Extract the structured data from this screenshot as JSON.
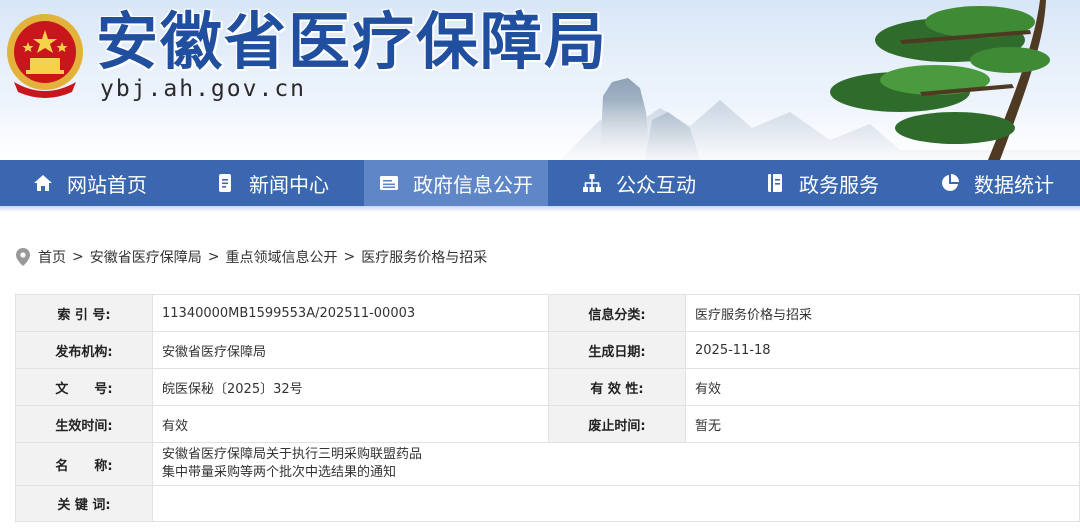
{
  "header": {
    "site_title": "安徽省医疗保障局",
    "site_url": "ybj.ah.gov.cn",
    "emblem_icon": "national-emblem-icon",
    "brand_color": "#1f4f9e"
  },
  "nav": {
    "items": [
      {
        "label": "网站首页",
        "icon": "home-icon"
      },
      {
        "label": "新闻中心",
        "icon": "document-icon"
      },
      {
        "label": "政府信息公开",
        "icon": "id-card-icon",
        "active": true
      },
      {
        "label": "公众互动",
        "icon": "org-chart-icon"
      },
      {
        "label": "政务服务",
        "icon": "book-icon"
      },
      {
        "label": "数据统计",
        "icon": "pie-chart-icon"
      }
    ],
    "bg_color": "#3a67b0",
    "active_color": "#5f86c6"
  },
  "breadcrumb": {
    "icon": "location-pin-icon",
    "items": [
      "首页",
      "安徽省医疗保障局",
      "重点领域信息公开",
      "医疗服务价格与招采"
    ],
    "separator": ">"
  },
  "info": {
    "index_label": "索 引 号:",
    "index_value": "11340000MB1599553A/202511-00003",
    "category_label": "信息分类:",
    "category_value": "医疗服务价格与招采",
    "publisher_label": "发布机构:",
    "publisher_value": "安徽省医疗保障局",
    "date_label": "生成日期:",
    "date_value": "2025-11-18",
    "docno_label": "文　　号:",
    "docno_value": "皖医保秘〔2025〕32号",
    "validity_label": "有 效 性:",
    "validity_value": "有效",
    "effective_label": "生效时间:",
    "effective_value": "有效",
    "expiry_label": "废止时间:",
    "expiry_value": "暂无",
    "name_label": "名　　称:",
    "name_line1": "安徽省医疗保障局关于执行三明采购联盟药品",
    "name_line2": "集中带量采购等两个批次中选结果的通知",
    "keywords_label": "关 键 词:",
    "keywords_value": ""
  }
}
